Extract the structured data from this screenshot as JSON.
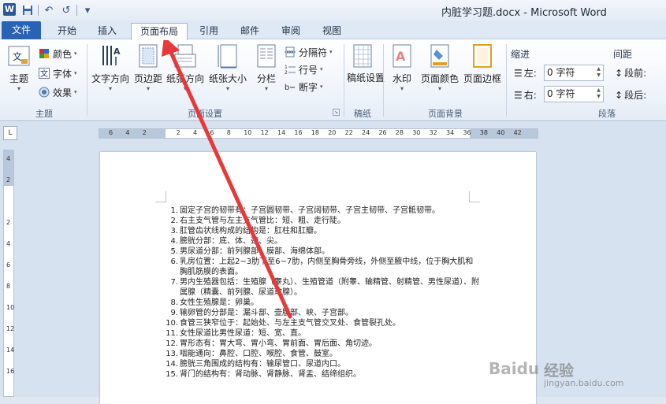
{
  "window": {
    "title": "内脏学习题.docx - Microsoft Word"
  },
  "qat": {
    "app_icon": "W",
    "save_icon": "💾",
    "undo_icon": "↶",
    "redo_icon": "↺",
    "customize_icon": "▾"
  },
  "tabs": [
    {
      "label": "文件"
    },
    {
      "label": "开始"
    },
    {
      "label": "插入"
    },
    {
      "label": "页面布局"
    },
    {
      "label": "引用"
    },
    {
      "label": "邮件"
    },
    {
      "label": "审阅"
    },
    {
      "label": "视图"
    }
  ],
  "ribbon": {
    "themes": {
      "group": "主题",
      "themes_btn": "主题",
      "colors": "颜色",
      "fonts": "字体",
      "effects": "效果"
    },
    "page_setup": {
      "group": "页面设置",
      "text_direction": "文字方向",
      "margins": "页边距",
      "orientation": "纸张方向",
      "size": "纸张大小",
      "columns": "分栏",
      "breaks": "分隔符",
      "line_numbers": "行号",
      "hyphenation": "断字"
    },
    "draft_paper": {
      "group": "稿纸",
      "setup": "稿纸设置"
    },
    "page_background": {
      "group": "页面背景",
      "watermark": "水印",
      "page_color": "页面颜色",
      "page_borders": "页面边框"
    },
    "paragraph": {
      "group": "段落",
      "indent_head": "缩进",
      "spacing_head": "间距",
      "left_label": "左:",
      "left_value": "0 字符",
      "right_label": "右:",
      "right_value": "0 字符",
      "before_label": "段前:",
      "after_label": "段后:"
    }
  },
  "ruler": {
    "corner": "L",
    "h_ticks": [
      "6",
      "4",
      "2",
      "",
      "2",
      "4",
      "6",
      "8",
      "10",
      "12",
      "14",
      "16",
      "18",
      "20",
      "22",
      "24",
      "26",
      "28",
      "30",
      "32",
      "34",
      "36",
      "38",
      "40",
      "42"
    ],
    "v_ticks": [
      "4",
      "2",
      "",
      "2",
      "4",
      "6",
      "8",
      "10",
      "12",
      "14",
      "16"
    ]
  },
  "document": {
    "items": [
      {
        "num": "1.",
        "text": "固定子宫的韧带有：子宫圆韧带、子宫阔韧带、子宫主韧带、子宫骶韧带。"
      },
      {
        "num": "2.",
        "text": "右主支气管与左主支气管比：短、粗、走行陡。"
      },
      {
        "num": "3.",
        "text": "肛管齿状线构成的结构是：肛柱和肛瓣。"
      },
      {
        "num": "4.",
        "text": "膀胱分部：底、体、颈、尖。"
      },
      {
        "num": "5.",
        "text": "男尿道分部：前列腺部、膜部、海绵体部。"
      },
      {
        "num": "6.",
        "text": "乳房位置：上起2~3肋下至6~7肋，内侧至胸骨旁线，外侧至腋中线，位于胸大肌和胸肌筋膜的表面。"
      },
      {
        "num": "7.",
        "text": "男内生殖器包括：生殖腺（睾丸）、生殖管道（附睾、输精管、射精管、男性尿道）、附属腺（精囊、前列腺、尿道球腺）。"
      },
      {
        "num": "8.",
        "text": "女性生殖腺是：卵巢。"
      },
      {
        "num": "9.",
        "text": "输卵管的分部是：漏斗部、壶腹部、峡、子宫部。"
      },
      {
        "num": "10.",
        "text": "食管三狭窄位于：起始处、与左主支气管交叉处、食管裂孔处。"
      },
      {
        "num": "11.",
        "text": "女性尿道比男性尿道：短、宽、直。"
      },
      {
        "num": "12.",
        "text": "胃形态有：胃大弯、胃小弯、胃前面、胃后面、角切迹。"
      },
      {
        "num": "13.",
        "text": "咽能通向：鼻腔、口腔、喉腔、食管、鼓室。"
      },
      {
        "num": "14.",
        "text": "膀胱三角围成的结构有：输尿管口、尿道内口。"
      },
      {
        "num": "15.",
        "text": "肾门的结构有：肾动脉、肾静脉、肾盂、结缔组织。"
      }
    ]
  },
  "watermark": {
    "logo": "Baidu",
    "text": "经验",
    "url": "jingyan.baidu.com"
  },
  "colors": {
    "file_tab": "#2a62b5",
    "annotation_arrow": "#e8393a"
  }
}
